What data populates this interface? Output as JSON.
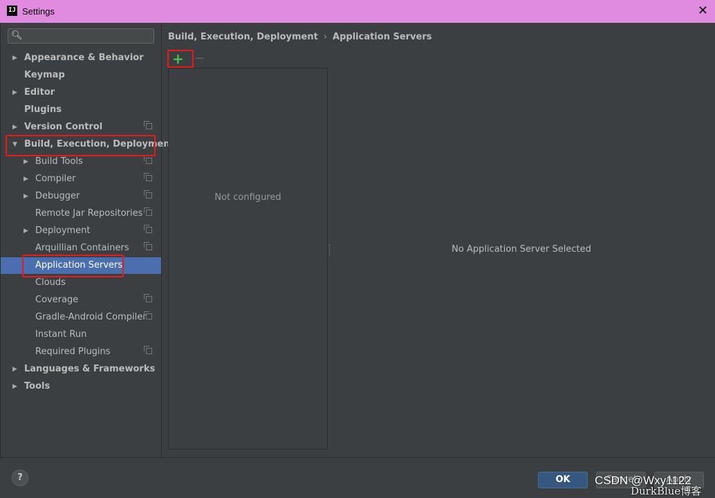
{
  "window": {
    "title": "Settings",
    "app_icon_text": "IJ",
    "close_glyph": "✕"
  },
  "search": {
    "icon": "search-icon",
    "value": ""
  },
  "tree": {
    "items": [
      {
        "label": "Appearance & Behavior",
        "expandable": true,
        "expanded": false,
        "bold": true
      },
      {
        "label": "Keymap",
        "expandable": false,
        "bold": true
      },
      {
        "label": "Editor",
        "expandable": true,
        "expanded": false,
        "bold": true
      },
      {
        "label": "Plugins",
        "expandable": false,
        "bold": true
      },
      {
        "label": "Version Control",
        "expandable": true,
        "expanded": false,
        "bold": true
      },
      {
        "label": "Build, Execution, Deployment",
        "expandable": true,
        "expanded": true,
        "bold": true
      },
      {
        "label": "Build Tools",
        "expandable": true,
        "expanded": false
      },
      {
        "label": "Compiler",
        "expandable": true,
        "expanded": false
      },
      {
        "label": "Debugger",
        "expandable": true,
        "expanded": false
      },
      {
        "label": "Remote Jar Repositories",
        "expandable": false
      },
      {
        "label": "Deployment",
        "expandable": true,
        "expanded": false
      },
      {
        "label": "Arquillian Containers",
        "expandable": false
      },
      {
        "label": "Application Servers",
        "expandable": false,
        "selected": true
      },
      {
        "label": "Clouds",
        "expandable": false
      },
      {
        "label": "Coverage",
        "expandable": false
      },
      {
        "label": "Gradle-Android Compiler",
        "expandable": false
      },
      {
        "label": "Instant Run",
        "expandable": false
      },
      {
        "label": "Required Plugins",
        "expandable": false
      },
      {
        "label": "Languages & Frameworks",
        "expandable": true,
        "expanded": false,
        "bold": true
      },
      {
        "label": "Tools",
        "expandable": true,
        "expanded": false,
        "bold": true
      }
    ]
  },
  "breadcrumb": {
    "parent": "Build, Execution, Deployment",
    "separator": "›",
    "current": "Application Servers"
  },
  "toolbar": {
    "add_glyph": "+",
    "remove_glyph": "−"
  },
  "server_list": {
    "empty_text": "Not configured"
  },
  "detail": {
    "empty_text": "No Application Server Selected"
  },
  "footer": {
    "help_label": "?",
    "ok_label": "OK",
    "cancel_label": "Cancel",
    "apply_label": "Apply"
  },
  "watermark": {
    "line1": "CSDN @Wxy1122",
    "line2": "DurkBlue博客"
  },
  "colors": {
    "title_bar": "#e08be0",
    "selection": "#4b6eaf",
    "highlight_box": "#e81b1b",
    "add_icon": "#4fc04f",
    "ok_button": "#365880"
  }
}
